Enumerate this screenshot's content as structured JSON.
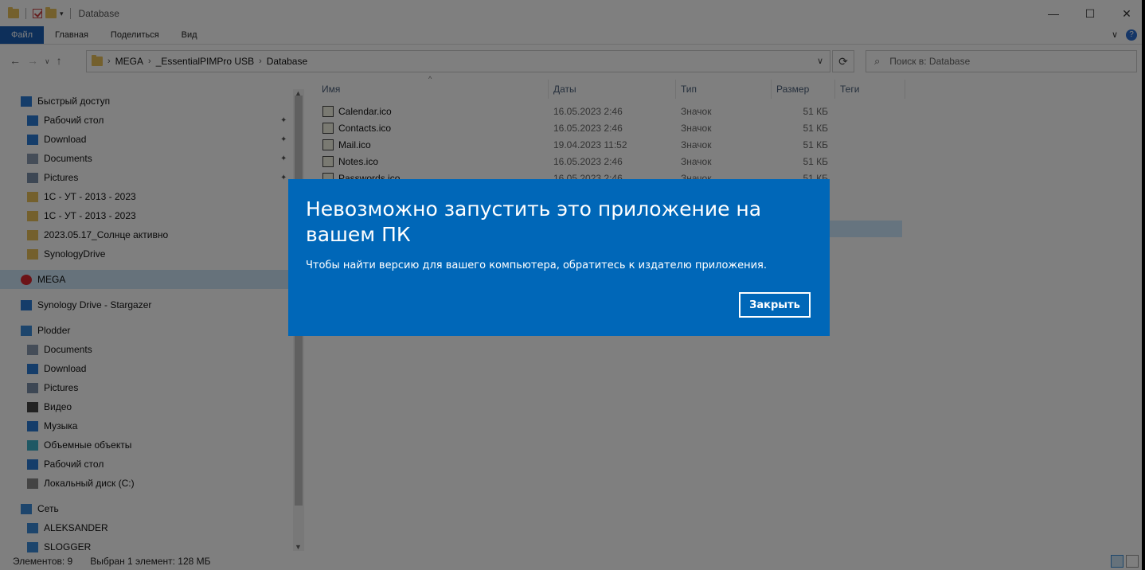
{
  "window": {
    "title": "Database",
    "controls": {
      "minimize": "—",
      "maximize": "☐",
      "close": "✕"
    }
  },
  "ribbon": {
    "tabs": [
      "Файл",
      "Главная",
      "Поделиться",
      "Вид"
    ],
    "expand": "∨",
    "help": "?"
  },
  "address": {
    "crumbs": [
      "MEGA",
      "_EssentialPIMPro USB",
      "Database"
    ],
    "search_placeholder": "Поиск в: Database"
  },
  "sidebar": {
    "items": [
      {
        "label": "Быстрый доступ",
        "icon": "star-icon",
        "pinned": false
      },
      {
        "label": "Рабочий стол",
        "icon": "desktop-icon",
        "pinned": true
      },
      {
        "label": "Download",
        "icon": "download-arrow-icon",
        "pinned": true
      },
      {
        "label": "Documents",
        "icon": "document-icon",
        "pinned": true
      },
      {
        "label": "Pictures",
        "icon": "pictures-icon",
        "pinned": true
      },
      {
        "label": "1С - УТ - 2013 - 2023",
        "icon": "folder-icon",
        "pinned": false
      },
      {
        "label": "1С - УТ - 2013 - 2023",
        "icon": "folder-synced-icon",
        "pinned": false
      },
      {
        "label": "2023.05.17_Солнце активно",
        "icon": "folder-icon",
        "pinned": false
      },
      {
        "label": "SynologyDrive",
        "icon": "folder-icon",
        "pinned": false
      },
      {
        "label": "MEGA",
        "icon": "mega-icon",
        "pinned": false
      },
      {
        "label": "Synology Drive - Stargazer",
        "icon": "synology-icon",
        "pinned": false
      },
      {
        "label": "Plodder",
        "icon": "computer-icon",
        "pinned": false
      },
      {
        "label": "Documents",
        "icon": "document-icon",
        "pinned": false
      },
      {
        "label": "Download",
        "icon": "download-arrow-icon",
        "pinned": false
      },
      {
        "label": "Pictures",
        "icon": "pictures-icon",
        "pinned": false
      },
      {
        "label": "Видео",
        "icon": "video-icon",
        "pinned": false
      },
      {
        "label": "Музыка",
        "icon": "music-icon",
        "pinned": false
      },
      {
        "label": "Объемные объекты",
        "icon": "3d-objects-icon",
        "pinned": false
      },
      {
        "label": "Рабочий стол",
        "icon": "desktop-icon",
        "pinned": false
      },
      {
        "label": "Локальный диск (C:)",
        "icon": "drive-icon",
        "pinned": false
      },
      {
        "label": "Сеть",
        "icon": "network-icon",
        "pinned": false
      },
      {
        "label": "ALEKSANDER",
        "icon": "computer-icon",
        "pinned": false
      },
      {
        "label": "SLOGGER",
        "icon": "computer-icon",
        "pinned": false
      }
    ]
  },
  "columns": [
    "Имя",
    "Даты",
    "Тип",
    "Размер",
    "Теги"
  ],
  "files": [
    {
      "name": "Calendar.ico",
      "date": "16.05.2023 2:46",
      "type": "Значок",
      "size": "51 КБ"
    },
    {
      "name": "Contacts.ico",
      "date": "16.05.2023 2:46",
      "type": "Значок",
      "size": "51 КБ"
    },
    {
      "name": "Mail.ico",
      "date": "19.04.2023 11:52",
      "type": "Значок",
      "size": "51 КБ"
    },
    {
      "name": "Notes.ico",
      "date": "16.05.2023 2:46",
      "type": "Значок",
      "size": "51 КБ"
    },
    {
      "name": "Passwords.ico",
      "date": "16.05.2023 2:46",
      "type": "Значок",
      "size": "51 КБ"
    }
  ],
  "status": {
    "count": "Элементов: 9",
    "selected": "Выбран 1 элемент: 128 МБ"
  },
  "dialog": {
    "title": "Невозможно запустить это приложение на вашем ПК",
    "message": "Чтобы найти версию для вашего компьютера, обратитесь к издателю приложения.",
    "close_button": "Закрыть",
    "background": "#0067b8"
  }
}
